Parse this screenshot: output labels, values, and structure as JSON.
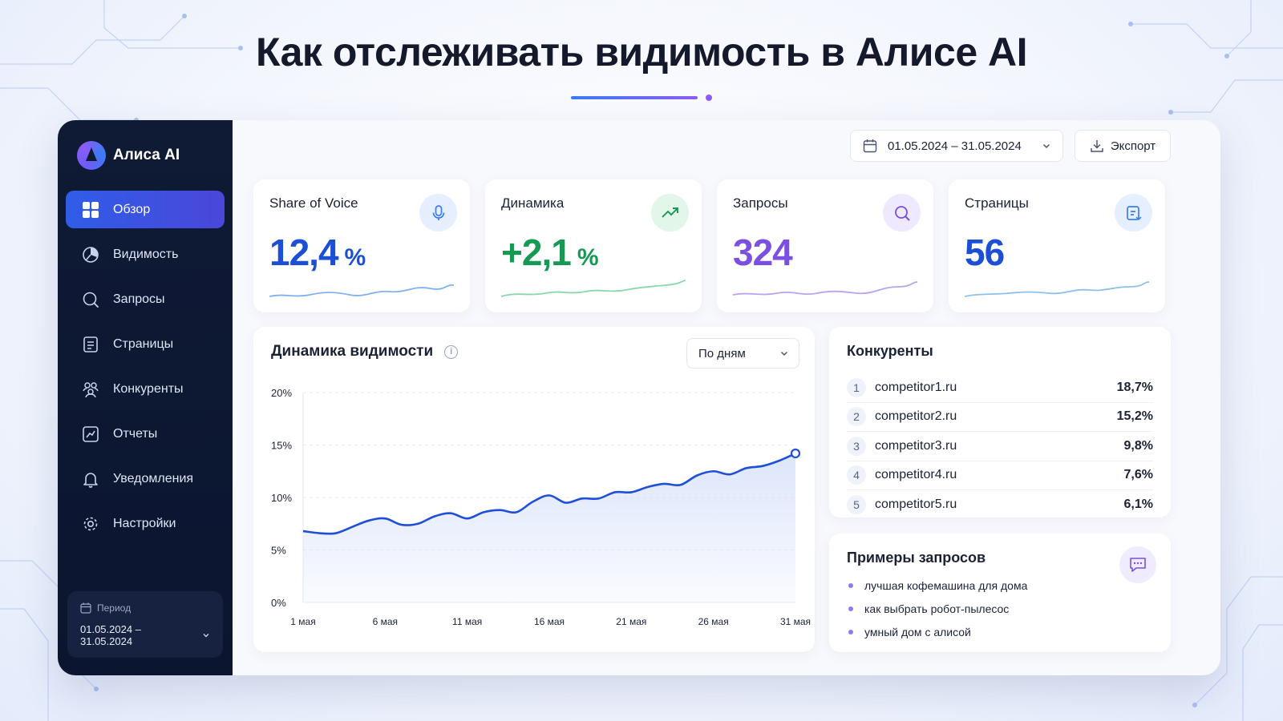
{
  "page": {
    "title": "Как отслеживать видимость в Алисе AI"
  },
  "brand": {
    "name": "Алиса AI"
  },
  "sidebar": {
    "items": [
      {
        "label": "Обзор",
        "icon": "grid-icon",
        "active": true
      },
      {
        "label": "Видимость",
        "icon": "pie-chart-icon",
        "active": false
      },
      {
        "label": "Запросы",
        "icon": "search-icon",
        "active": false
      },
      {
        "label": "Страницы",
        "icon": "document-icon",
        "active": false
      },
      {
        "label": "Конкуренты",
        "icon": "users-icon",
        "active": false
      },
      {
        "label": "Отчеты",
        "icon": "report-icon",
        "active": false
      },
      {
        "label": "Уведомления",
        "icon": "bell-icon",
        "active": false
      },
      {
        "label": "Настройки",
        "icon": "gear-icon",
        "active": false
      }
    ],
    "period": {
      "label": "Период",
      "value": "01.05.2024 – 31.05.2024"
    }
  },
  "toolbar": {
    "date_range": "01.05.2024 – 31.05.2024",
    "export_label": "Экспорт"
  },
  "kpis": [
    {
      "label": "Share of Voice",
      "value": "12,4",
      "unit": "%",
      "color": "#1c4fd6",
      "icon": "microphone-icon",
      "icon_bg": "#e6efff",
      "spark_color": "#7fb1f0"
    },
    {
      "label": "Динамика",
      "value": "+2,1",
      "unit": "%",
      "color": "#149a52",
      "icon": "trend-up-icon",
      "icon_bg": "#e2f6ea",
      "spark_color": "#8bd6ac"
    },
    {
      "label": "Запросы",
      "value": "324",
      "unit": "",
      "color": "#7b4fe0",
      "icon": "search-icon",
      "icon_bg": "#efe9ff",
      "spark_color": "#b9a3ef"
    },
    {
      "label": "Страницы",
      "value": "56",
      "unit": "",
      "color": "#1c4fd6",
      "icon": "document-icon",
      "icon_bg": "#e6efff",
      "spark_color": "#8cc0ef"
    }
  ],
  "visibility_chart": {
    "title": "Динамика видимости",
    "granularity": "По дням"
  },
  "chart_data": {
    "type": "area",
    "title": "Динамика видимости",
    "xlabel": "",
    "ylabel": "",
    "x": [
      "1 мая",
      "2 мая",
      "3 мая",
      "4 мая",
      "5 мая",
      "6 мая",
      "7 мая",
      "8 мая",
      "9 мая",
      "10 мая",
      "11 мая",
      "12 мая",
      "13 мая",
      "14 мая",
      "15 мая",
      "16 мая",
      "17 мая",
      "18 мая",
      "19 мая",
      "20 мая",
      "21 мая",
      "22 мая",
      "23 мая",
      "24 мая",
      "25 мая",
      "26 мая",
      "27 мая",
      "28 мая",
      "29 мая",
      "30 мая",
      "31 мая"
    ],
    "x_tick_labels": [
      "1 мая",
      "6 мая",
      "11 мая",
      "16 мая",
      "21 мая",
      "26 мая",
      "31 мая"
    ],
    "y_ticks": [
      "0%",
      "5%",
      "10%",
      "15%",
      "20%"
    ],
    "ylim": [
      0,
      20
    ],
    "grid": true,
    "series": [
      {
        "values": [
          6.8,
          6.6,
          6.6,
          7.2,
          7.8,
          8.0,
          7.4,
          7.5,
          8.2,
          8.5,
          8.0,
          8.6,
          8.8,
          8.6,
          9.6,
          10.2,
          9.5,
          9.9,
          9.9,
          10.5,
          10.5,
          11.0,
          11.3,
          11.2,
          12.1,
          12.5,
          12.2,
          12.8,
          13.0,
          13.5,
          14.2
        ]
      }
    ],
    "colors": {
      "line": "#1f4fd8",
      "fill": "#dbe4fb"
    }
  },
  "competitors": {
    "title": "Конкуренты",
    "rows": [
      {
        "rank": "1",
        "domain": "competitor1.ru",
        "share": "18,7%"
      },
      {
        "rank": "2",
        "domain": "competitor2.ru",
        "share": "15,2%"
      },
      {
        "rank": "3",
        "domain": "competitor3.ru",
        "share": "9,8%"
      },
      {
        "rank": "4",
        "domain": "competitor4.ru",
        "share": "7,6%"
      },
      {
        "rank": "5",
        "domain": "competitor5.ru",
        "share": "6,1%"
      }
    ]
  },
  "query_examples": {
    "title": "Примеры запросов",
    "items": [
      "лучшая кофемашина для дома",
      "как выбрать робот-пылесос",
      "умный дом с алисой"
    ]
  },
  "colors": {
    "sidebar_bg": "#0f1a35",
    "accent": "#2f5de8",
    "purple": "#8b5cf6"
  }
}
